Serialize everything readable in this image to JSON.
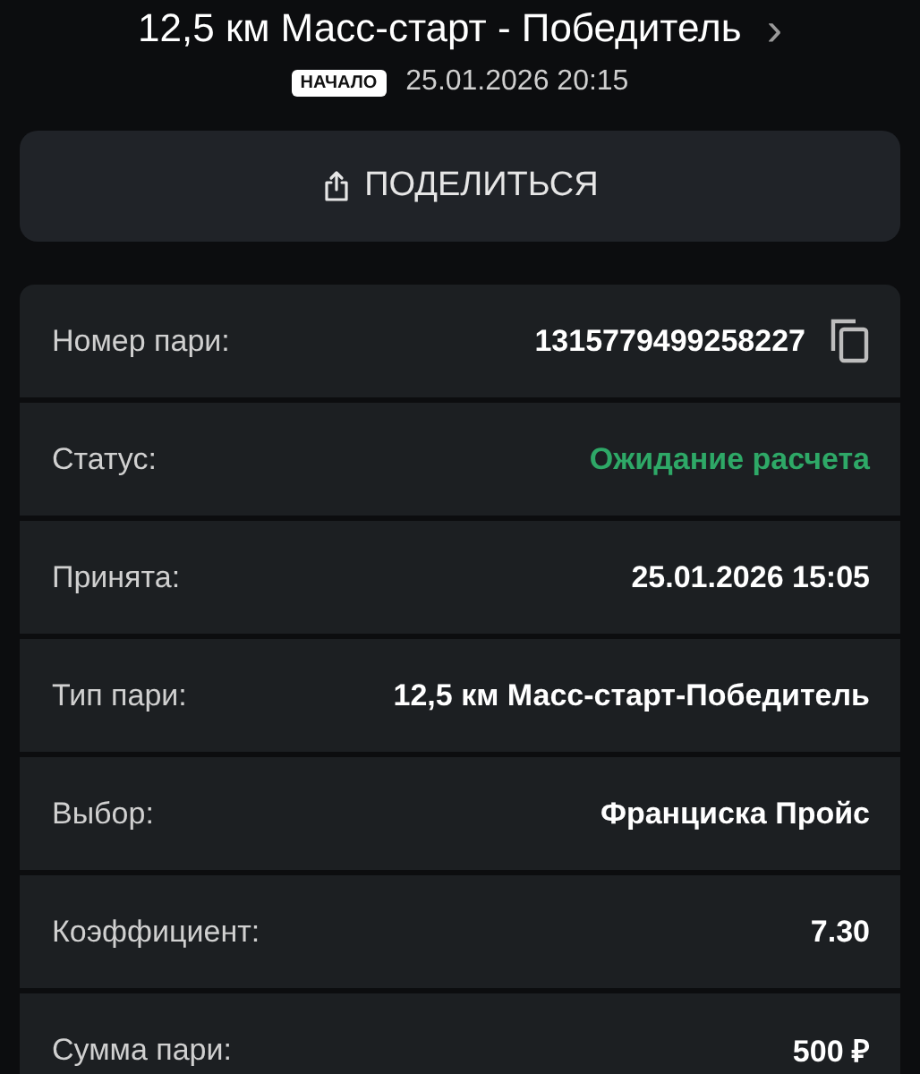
{
  "event": {
    "title": "12,5 км Масс-старт - Победитель",
    "chevron": "›",
    "badge": "НАЧАЛО",
    "start_time": "25.01.2026 20:15"
  },
  "share_button": {
    "label": "ПОДЕЛИТЬСЯ"
  },
  "details": [
    {
      "kind": "copy",
      "label": "Номер пари:",
      "value": "1315779499258227"
    },
    {
      "kind": "status",
      "label": "Статус:",
      "value": "Ожидание расчета"
    },
    {
      "kind": "plain",
      "label": "Принята:",
      "value": "25.01.2026 15:05"
    },
    {
      "kind": "plain",
      "label": "Тип пари:",
      "value": "12,5 км Масс-старт-Победитель"
    },
    {
      "kind": "plain",
      "label": "Выбор:",
      "value": "Франциска Пройс"
    },
    {
      "kind": "plain",
      "label": "Коэффициент:",
      "value": "7.30"
    },
    {
      "kind": "plain",
      "label": "Сумма пари:",
      "value": "500 ₽"
    }
  ]
}
